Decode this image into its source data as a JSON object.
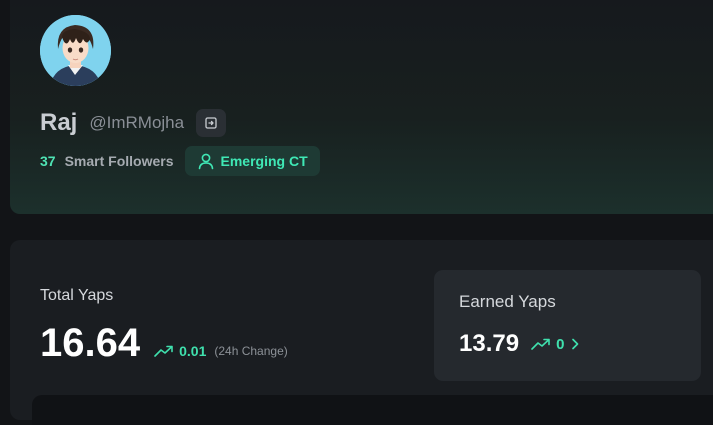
{
  "profile": {
    "name": "Raj",
    "handle": "@ImRMojha",
    "smart_followers_count": "37",
    "smart_followers_label": "Smart Followers",
    "badge_label": "Emerging CT",
    "handle_button_icon": "external-link-icon",
    "badge_icon": "user-icon"
  },
  "stats": {
    "total_label": "Total Yaps",
    "total_value": "16.64",
    "total_change": "0.01",
    "total_change_note": "(24h Change)",
    "earned_label": "Earned Yaps",
    "earned_value": "13.79",
    "earned_change": "0"
  },
  "colors": {
    "accent": "#3fe0ad",
    "background": "#121417",
    "card": "#1a1d21",
    "badge_bg": "#1e3a34"
  }
}
